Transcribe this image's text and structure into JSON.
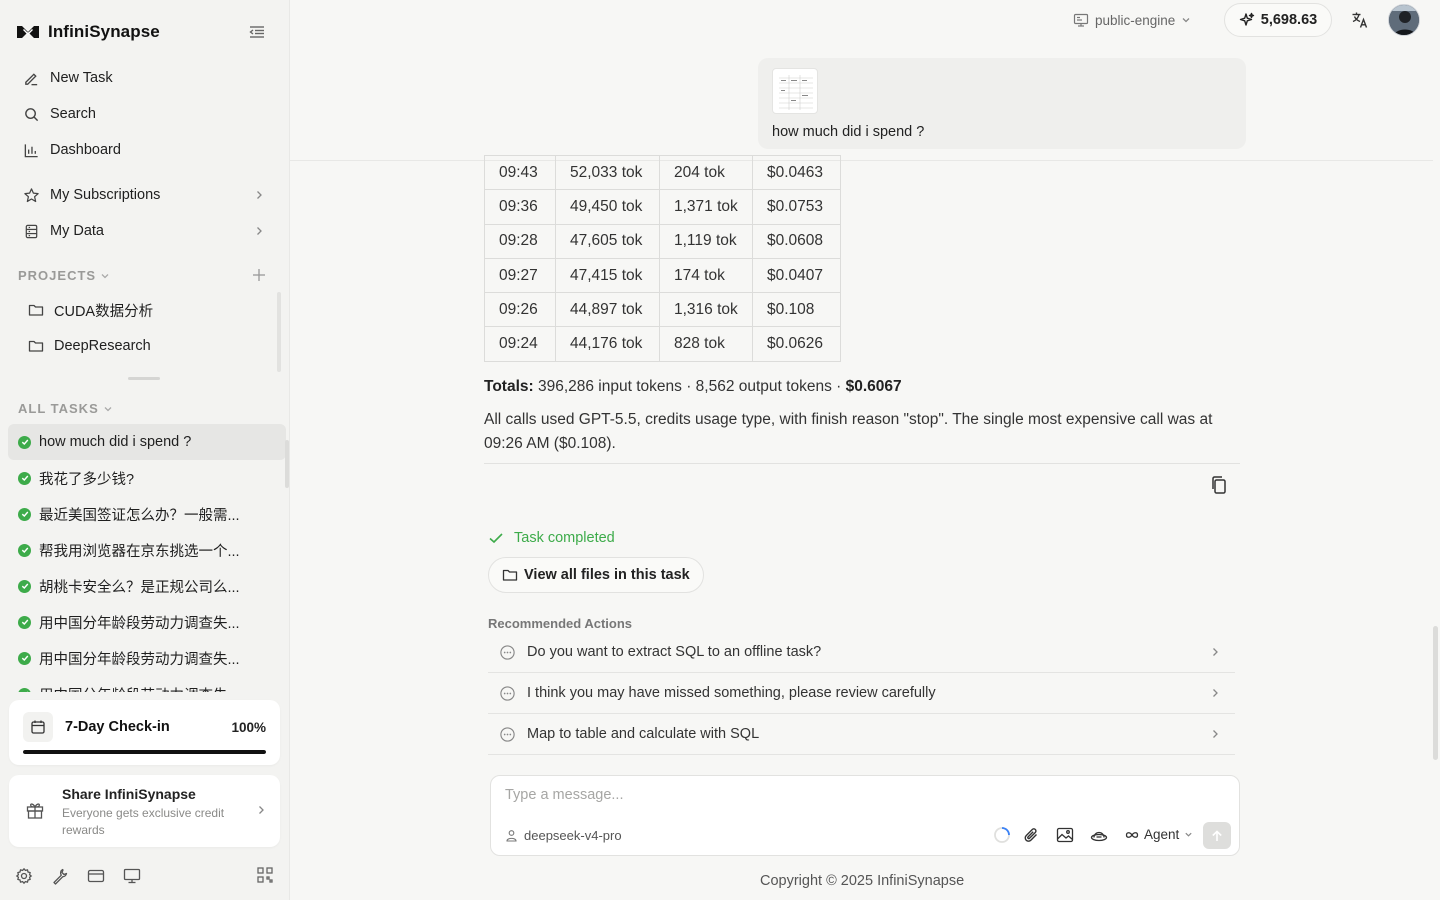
{
  "app": {
    "name": "InfiniSynapse"
  },
  "nav": {
    "new_task": "New Task",
    "search": "Search",
    "dashboard": "Dashboard",
    "subscriptions": "My Subscriptions",
    "my_data": "My Data"
  },
  "projects": {
    "header": "PROJECTS",
    "items": [
      {
        "label": "CUDA数据分析"
      },
      {
        "label": "DeepResearch"
      }
    ]
  },
  "tasks": {
    "header": "ALL TASKS",
    "items": [
      {
        "label": "how much did i spend ?",
        "status": "completed",
        "active": true
      },
      {
        "label": "我花了多少钱?",
        "status": "completed"
      },
      {
        "label": "最近美国签证怎么办？一般需...",
        "status": "completed"
      },
      {
        "label": "帮我用浏览器在京东挑选一个...",
        "status": "completed"
      },
      {
        "label": "胡桃卡安全么？是正规公司么...",
        "status": "completed"
      },
      {
        "label": "用中国分年龄段劳动力调查失...",
        "status": "completed"
      },
      {
        "label": "用中国分年龄段劳动力调查失...",
        "status": "completed"
      },
      {
        "label": "用中国分年龄段劳动力调查失...",
        "status": "completed"
      }
    ]
  },
  "checkin": {
    "title": "7-Day Check-in",
    "percent_label": "100%",
    "progress": 1.0
  },
  "share": {
    "title": "Share InfiniSynapse",
    "subtitle": "Everyone gets exclusive credit rewards"
  },
  "topbar": {
    "engine": "public-engine",
    "credits": "5,698.63"
  },
  "chat": {
    "user_message": "how much did i spend ?",
    "table": {
      "rows": [
        [
          "09:43",
          "52,033 tok",
          "204 tok",
          "$0.0463"
        ],
        [
          "09:36",
          "49,450 tok",
          "1,371 tok",
          "$0.0753"
        ],
        [
          "09:28",
          "47,605 tok",
          "1,119 tok",
          "$0.0608"
        ],
        [
          "09:27",
          "47,415 tok",
          "174 tok",
          "$0.0407"
        ],
        [
          "09:26",
          "44,897 tok",
          "1,316 tok",
          "$0.108"
        ],
        [
          "09:24",
          "44,176 tok",
          "828 tok",
          "$0.0626"
        ]
      ]
    },
    "totals_label": "Totals:",
    "totals_text": " 396,286 input tokens · 8,562 output tokens · ",
    "totals_amount": "$0.6067",
    "summary": "All calls used GPT-5.5, credits usage type, with finish reason \"stop\". The single most expensive call was at 09:26 AM ($0.108).",
    "task_status": "Task completed",
    "view_files": "View all files in this task"
  },
  "recommended": {
    "title": "Recommended Actions",
    "items": [
      {
        "label": "Do you want to extract SQL to an offline task?"
      },
      {
        "label": "I think you may have missed something, please review carefully"
      },
      {
        "label": "Map to table and calculate with SQL"
      }
    ]
  },
  "composer": {
    "placeholder": "Type a message...",
    "model": "deepseek-v4-pro",
    "agent": "Agent"
  },
  "footer": {
    "copyright": "Copyright © 2025 InfiniSynapse"
  },
  "colors": {
    "success": "#3dab4a",
    "sidebar_bg": "#f3f3f1",
    "main_bg": "#f7f7f5"
  }
}
